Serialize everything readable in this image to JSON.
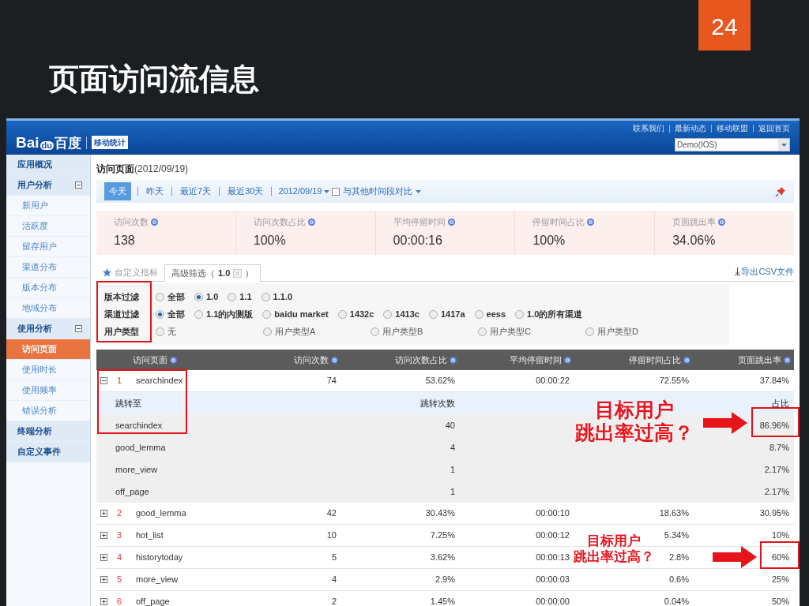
{
  "slide": {
    "page_number": "24",
    "title": "页面访问流信息"
  },
  "header": {
    "logo": {
      "latin": "Bai",
      "paw": "du",
      "cn": "百度"
    },
    "product": "移动统计",
    "links": [
      "联系我们",
      "最新动态",
      "移动联盟",
      "返回首页"
    ],
    "app_select": {
      "value": "Demo(IOS)"
    }
  },
  "sidebar": {
    "items": [
      {
        "label": "应用概况",
        "kind": "group",
        "selected": false
      },
      {
        "label": "用户分析",
        "kind": "group",
        "selected": false,
        "expanded": true
      },
      {
        "label": "新用户",
        "kind": "item",
        "selected": false
      },
      {
        "label": "活跃度",
        "kind": "item",
        "selected": false
      },
      {
        "label": "留存用户",
        "kind": "item",
        "selected": false
      },
      {
        "label": "渠道分布",
        "kind": "item",
        "selected": false
      },
      {
        "label": "版本分布",
        "kind": "item",
        "selected": false
      },
      {
        "label": "地域分布",
        "kind": "item",
        "selected": false
      },
      {
        "label": "使用分析",
        "kind": "group",
        "selected": false,
        "expanded": true
      },
      {
        "label": "访问页面",
        "kind": "item",
        "selected": true
      },
      {
        "label": "使用时长",
        "kind": "item",
        "selected": false
      },
      {
        "label": "使用频率",
        "kind": "item",
        "selected": false
      },
      {
        "label": "错误分析",
        "kind": "item",
        "selected": false
      },
      {
        "label": "终端分析",
        "kind": "group",
        "selected": false
      },
      {
        "label": "自定义事件",
        "kind": "group",
        "selected": false
      }
    ]
  },
  "page": {
    "title": "访问页面",
    "date": "(2012/09/19)"
  },
  "date_bar": {
    "ranges": [
      {
        "label": "今天",
        "selected": true
      },
      {
        "label": "昨天",
        "selected": false
      },
      {
        "label": "最近7天",
        "selected": false
      },
      {
        "label": "最近30天",
        "selected": false
      }
    ],
    "date": "2012/09/19",
    "compare": {
      "label": "与其他时间段对比",
      "checked": false
    }
  },
  "stats": [
    {
      "label": "访问次数",
      "value": "138"
    },
    {
      "label": "访问次数占比",
      "value": "100%"
    },
    {
      "label": "平均停留时间",
      "value": "00:00:16"
    },
    {
      "label": "停留时间占比",
      "value": "100%"
    },
    {
      "label": "页面跳出率",
      "value": "34.06%"
    }
  ],
  "tabs": [
    {
      "kind": "star",
      "label": "自定义指标",
      "selected": false
    },
    {
      "kind": "filter",
      "label": "高级筛选（",
      "chip": "1.0",
      "suffix": "）",
      "selected": true
    }
  ],
  "export": "导出CSV文件",
  "filters": [
    {
      "label": "版本过滤",
      "options": [
        {
          "label": "全部",
          "selected": false
        },
        {
          "label": "1.0",
          "selected": true
        },
        {
          "label": "1.1",
          "selected": false
        },
        {
          "label": "1.1.0",
          "selected": false
        }
      ]
    },
    {
      "label": "渠道过滤",
      "options": [
        {
          "label": "全部",
          "selected": true
        },
        {
          "label": "1.1的内测版",
          "selected": false
        },
        {
          "label": "baidu market",
          "selected": false
        },
        {
          "label": "1432c",
          "selected": false
        },
        {
          "label": "1413c",
          "selected": false
        },
        {
          "label": "1417a",
          "selected": false
        },
        {
          "label": "eess",
          "selected": false
        },
        {
          "label": "1.0的所有渠道",
          "selected": false
        }
      ]
    },
    {
      "label": "用户类型",
      "options": [
        {
          "label": "无",
          "selected": false
        },
        {
          "label": "用户类型A",
          "selected": false
        },
        {
          "label": "用户类型B",
          "selected": false
        },
        {
          "label": "用户类型C",
          "selected": false
        },
        {
          "label": "用户类型D",
          "selected": false
        }
      ]
    }
  ],
  "table": {
    "columns": [
      "访问页面",
      "访问次数",
      "访问次数占比",
      "平均停留时间",
      "停留时间占比",
      "页面跳出率"
    ],
    "rows": [
      {
        "kind": "page",
        "expanded": true,
        "index": "1",
        "name": "searchindex",
        "cells": [
          "74",
          "53.62%",
          "00:00:22",
          "72.55%",
          "37.84%"
        ]
      },
      {
        "kind": "jump_header",
        "name": "跳转至",
        "count": "跳转次数",
        "share": "占比"
      },
      {
        "kind": "jump",
        "name": "searchindex",
        "count": "40",
        "share": "86.96%"
      },
      {
        "kind": "jump",
        "name": "good_lemma",
        "count": "4",
        "share": "8.7%"
      },
      {
        "kind": "jump",
        "name": "more_view",
        "count": "1",
        "share": "2.17%"
      },
      {
        "kind": "jump",
        "name": "off_page",
        "count": "1",
        "share": "2.17%"
      },
      {
        "kind": "page",
        "expanded": false,
        "index": "2",
        "name": "good_lemma",
        "cells": [
          "42",
          "30.43%",
          "00:00:10",
          "18.63%",
          "30.95%"
        ]
      },
      {
        "kind": "page",
        "expanded": false,
        "index": "3",
        "name": "hot_list",
        "cells": [
          "10",
          "7.25%",
          "00:00:12",
          "5.34%",
          "10%"
        ]
      },
      {
        "kind": "page",
        "expanded": false,
        "index": "4",
        "name": "historytoday",
        "cells": [
          "5",
          "3.62%",
          "00:00:13",
          "2.8%",
          "60%"
        ]
      },
      {
        "kind": "page",
        "expanded": false,
        "index": "5",
        "name": "more_view",
        "cells": [
          "4",
          "2.9%",
          "00:00:03",
          "0.6%",
          "25%"
        ]
      },
      {
        "kind": "page",
        "expanded": false,
        "index": "6",
        "name": "off_page",
        "cells": [
          "2",
          "1.45%",
          "00:00:00",
          "0.04%",
          "50%"
        ]
      }
    ]
  },
  "annotations": [
    {
      "lines": [
        "目标用户",
        "跳出率过高？"
      ]
    },
    {
      "lines": [
        "目标用户",
        "跳出率过高？"
      ]
    }
  ]
}
